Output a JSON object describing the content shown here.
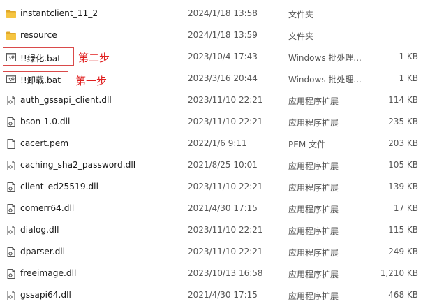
{
  "files": [
    {
      "icon": "folder-icon",
      "name": "instantclient_11_2",
      "date": "2024/1/18 13:58",
      "type": "文件夹",
      "size": ""
    },
    {
      "icon": "folder-icon",
      "name": "resource",
      "date": "2024/1/18 13:59",
      "type": "文件夹",
      "size": ""
    },
    {
      "icon": "batch-file-icon",
      "name": "!!绿化.bat",
      "date": "2023/10/4 17:43",
      "type": "Windows 批处理...",
      "size": "1 KB"
    },
    {
      "icon": "batch-file-icon",
      "name": "!!卸载.bat",
      "date": "2023/3/16 20:44",
      "type": "Windows 批处理...",
      "size": "1 KB"
    },
    {
      "icon": "dll-file-icon",
      "name": "auth_gssapi_client.dll",
      "date": "2023/11/10 22:21",
      "type": "应用程序扩展",
      "size": "114 KB"
    },
    {
      "icon": "dll-file-icon",
      "name": "bson-1.0.dll",
      "date": "2023/11/10 22:21",
      "type": "应用程序扩展",
      "size": "235 KB"
    },
    {
      "icon": "blank-file-icon",
      "name": "cacert.pem",
      "date": "2022/1/6 9:11",
      "type": "PEM 文件",
      "size": "203 KB"
    },
    {
      "icon": "dll-file-icon",
      "name": "caching_sha2_password.dll",
      "date": "2021/8/25 10:01",
      "type": "应用程序扩展",
      "size": "105 KB"
    },
    {
      "icon": "dll-file-icon",
      "name": "client_ed25519.dll",
      "date": "2023/11/10 22:21",
      "type": "应用程序扩展",
      "size": "139 KB"
    },
    {
      "icon": "dll-file-icon",
      "name": "comerr64.dll",
      "date": "2021/4/30 17:15",
      "type": "应用程序扩展",
      "size": "17 KB"
    },
    {
      "icon": "dll-file-icon",
      "name": "dialog.dll",
      "date": "2023/11/10 22:21",
      "type": "应用程序扩展",
      "size": "115 KB"
    },
    {
      "icon": "dll-file-icon",
      "name": "dparser.dll",
      "date": "2023/11/10 22:21",
      "type": "应用程序扩展",
      "size": "249 KB"
    },
    {
      "icon": "dll-file-icon",
      "name": "freeimage.dll",
      "date": "2023/10/13 16:58",
      "type": "应用程序扩展",
      "size": "1,210 KB"
    },
    {
      "icon": "dll-file-icon",
      "name": "gssapi64.dll",
      "date": "2021/4/30 17:15",
      "type": "应用程序扩展",
      "size": "468 KB"
    }
  ],
  "annotations": {
    "step2": "第二步",
    "step1": "第一步",
    "color": "#e02020"
  },
  "colors": {
    "folder": "#f5c441",
    "folder_dark": "#e0a82a",
    "text_secondary": "#555555"
  }
}
